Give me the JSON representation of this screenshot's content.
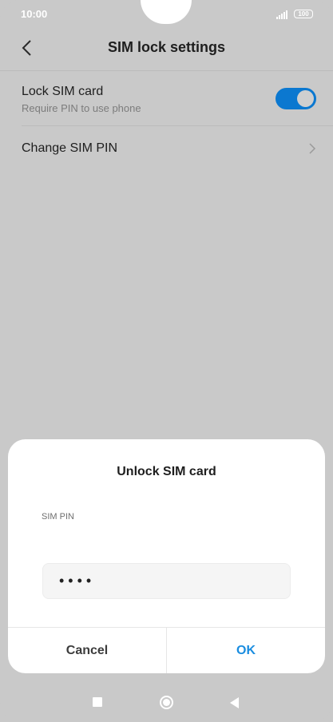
{
  "status_bar": {
    "time": "10:00",
    "battery": "100",
    "signal_icon": "signal-icon",
    "battery_icon": "battery-icon"
  },
  "header": {
    "title": "SIM lock settings",
    "back_icon": "back-icon"
  },
  "settings": {
    "lock_sim": {
      "title": "Lock SIM card",
      "subtitle": "Require PIN to use phone",
      "enabled": true
    },
    "change_pin": {
      "title": "Change SIM PIN",
      "icon": "chevron-right-icon"
    }
  },
  "dialog": {
    "title": "Unlock SIM card",
    "field_label": "SIM PIN",
    "pin_value": "••••",
    "cancel_label": "Cancel",
    "ok_label": "OK"
  },
  "colors": {
    "accent": "#0b78d0",
    "ok_button": "#1a8de0",
    "dim_background": "#c9c9c9"
  },
  "nav_bar": {
    "icons": [
      "recents-icon",
      "home-icon",
      "back-triangle-icon"
    ]
  }
}
